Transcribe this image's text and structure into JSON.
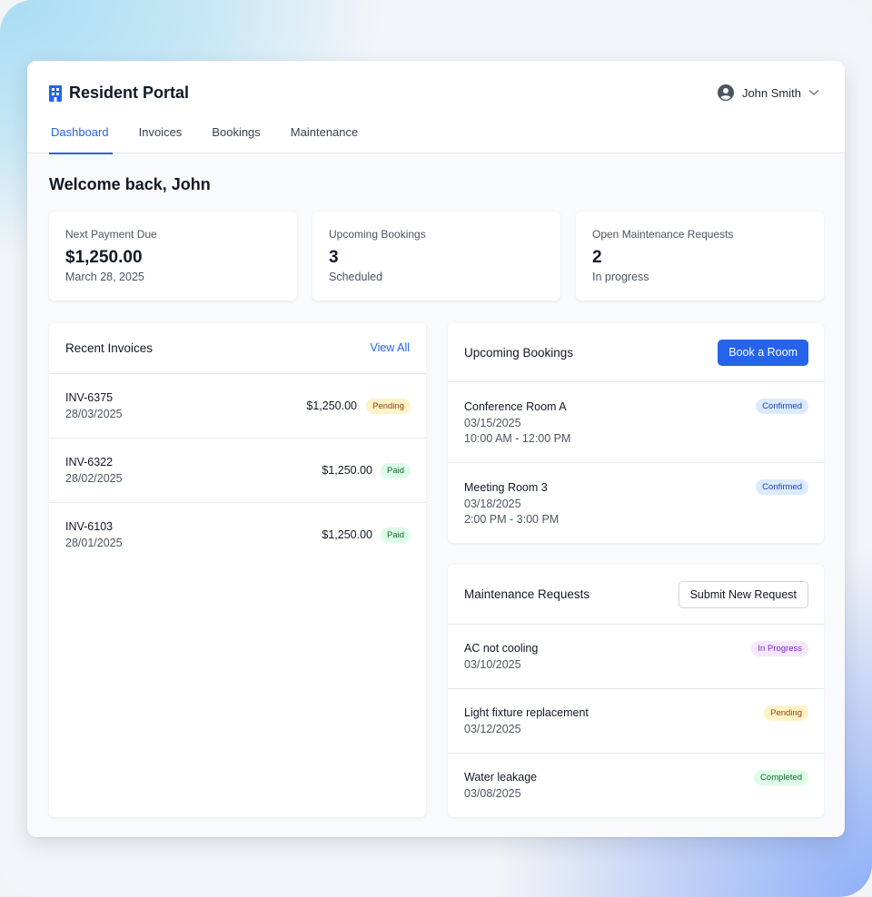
{
  "header": {
    "title": "Resident Portal",
    "icon": "building-icon",
    "user_name": "John Smith"
  },
  "tabs": [
    {
      "label": "Dashboard",
      "active": true
    },
    {
      "label": "Invoices",
      "active": false
    },
    {
      "label": "Bookings",
      "active": false
    },
    {
      "label": "Maintenance",
      "active": false
    }
  ],
  "welcome": "Welcome back, John",
  "stats": [
    {
      "label": "Next Payment Due",
      "value": "$1,250.00",
      "sub": "March 28, 2025"
    },
    {
      "label": "Upcoming Bookings",
      "value": "3",
      "sub": "Scheduled"
    },
    {
      "label": "Open Maintenance Requests",
      "value": "2",
      "sub": "In progress"
    }
  ],
  "invoices": {
    "title": "Recent Invoices",
    "view_all": "View All",
    "items": [
      {
        "id": "INV-6375",
        "date": "28/03/2025",
        "amount": "$1,250.00",
        "status": "Pending"
      },
      {
        "id": "INV-6322",
        "date": "28/02/2025",
        "amount": "$1,250.00",
        "status": "Paid"
      },
      {
        "id": "INV-6103",
        "date": "28/01/2025",
        "amount": "$1,250.00",
        "status": "Paid"
      }
    ]
  },
  "bookings": {
    "title": "Upcoming Bookings",
    "button": "Book a Room",
    "items": [
      {
        "room": "Conference Room A",
        "date": "03/15/2025",
        "time": "10:00 AM - 12:00 PM",
        "status": "Confirmed"
      },
      {
        "room": "Meeting Room 3",
        "date": "03/18/2025",
        "time": "2:00 PM - 3:00 PM",
        "status": "Confirmed"
      }
    ]
  },
  "maintenance": {
    "title": "Maintenance Requests",
    "button": "Submit New Request",
    "items": [
      {
        "title": "AC not cooling",
        "date": "03/10/2025",
        "status": "In Progress"
      },
      {
        "title": "Light fixture replacement",
        "date": "03/12/2025",
        "status": "Pending"
      },
      {
        "title": "Water leakage",
        "date": "03/08/2025",
        "status": "Completed"
      }
    ]
  },
  "colors": {
    "accent": "#2563eb",
    "pending_bg": "#fef3c7",
    "paid_bg": "#dcfce7",
    "confirmed_bg": "#dbeafe",
    "in_progress_bg": "#f3e8ff"
  }
}
